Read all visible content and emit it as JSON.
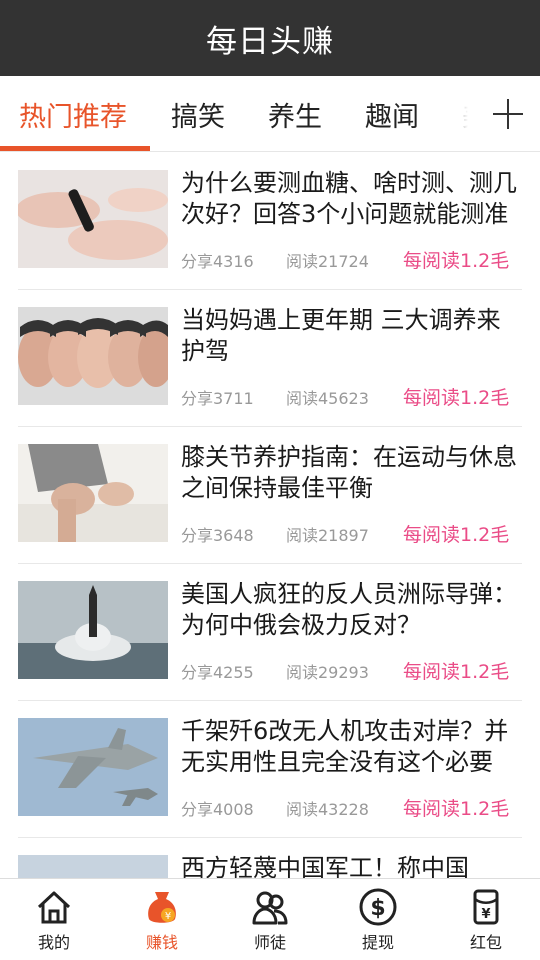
{
  "app": {
    "title": "每日头赚"
  },
  "tabs": [
    {
      "label": "热门推荐"
    },
    {
      "label": "搞笑"
    },
    {
      "label": "养生"
    },
    {
      "label": "趣闻"
    },
    {
      "label": "美"
    }
  ],
  "articles": [
    {
      "title": "为什么要测血糖、啥时测、测几次好？回答3个小问题就能测准",
      "share": "分享4316",
      "read": "阅读21724",
      "reward": "每阅读1.2毛"
    },
    {
      "title": "当妈妈遇上更年期 三大调养来护驾",
      "share": "分享3711",
      "read": "阅读45623",
      "reward": "每阅读1.2毛"
    },
    {
      "title": "膝关节养护指南：在运动与休息之间保持最佳平衡",
      "share": "分享3648",
      "read": "阅读21897",
      "reward": "每阅读1.2毛"
    },
    {
      "title": "美国人疯狂的反人员洲际导弹：为何中俄会极力反对？",
      "share": "分享4255",
      "read": "阅读29293",
      "reward": "每阅读1.2毛"
    },
    {
      "title": "千架歼6改无人机攻击对岸？并无实用性且完全没有这个必要",
      "share": "分享4008",
      "read": "阅读43228",
      "reward": "每阅读1.2毛"
    },
    {
      "title": "西方轻蔑中国军工！称中国",
      "share": "",
      "read": "",
      "reward": ""
    }
  ],
  "bottom_nav": [
    {
      "label": "我的",
      "icon": "home-icon"
    },
    {
      "label": "赚钱",
      "icon": "money-bag-icon"
    },
    {
      "label": "师徒",
      "icon": "people-icon"
    },
    {
      "label": "提现",
      "icon": "dollar-coin-icon"
    },
    {
      "label": "红包",
      "icon": "red-envelope-icon"
    }
  ],
  "colors": {
    "accent": "#e8542a",
    "reward": "#ea4c87",
    "titlebar": "#333333"
  }
}
